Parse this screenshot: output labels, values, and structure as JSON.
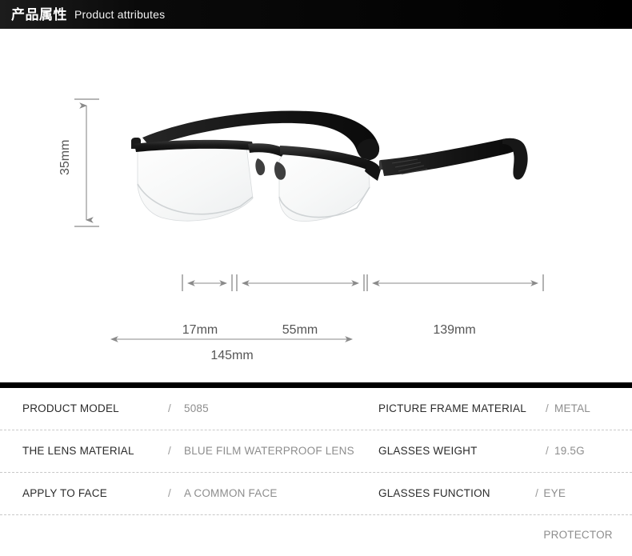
{
  "header": {
    "title_cn": "产品属性",
    "title_en": "Product attributes"
  },
  "product_image": {
    "alt_name": "black-semi-rimless-eyeglasses"
  },
  "dimensions": {
    "lens_height": "35mm",
    "bridge_width": "17mm",
    "lens_width": "55mm",
    "temple_length": "139mm",
    "total_width": "145mm"
  },
  "spec_table": {
    "rows": [
      {
        "left": {
          "label": "PRODUCT MODEL",
          "sep": "/",
          "value": "5085"
        },
        "right": {
          "label": "PICTURE FRAME MATERIAL",
          "sep": "/",
          "value": "METAL"
        }
      },
      {
        "left": {
          "label": "THE LENS MATERIAL",
          "sep": "/",
          "value": "BLUE FILM WATERPROOF LENS"
        },
        "right": {
          "label": "GLASSES WEIGHT",
          "sep": "/",
          "value": "19.5G"
        }
      },
      {
        "left": {
          "label": "APPLY TO FACE",
          "sep": "/",
          "value": "A COMMON FACE"
        },
        "right": {
          "label": "GLASSES FUNCTION",
          "sep": "/",
          "value": "EYE PROTECTOR"
        }
      }
    ]
  },
  "colors": {
    "header_bg": "#000000",
    "header_text": "#ffffff",
    "page_bg": "#ffffff",
    "dimension_line": "#8a8a8a",
    "label_text": "#2b2b2b",
    "value_text": "#8d8d8d",
    "divider": "#c9c9c9"
  }
}
